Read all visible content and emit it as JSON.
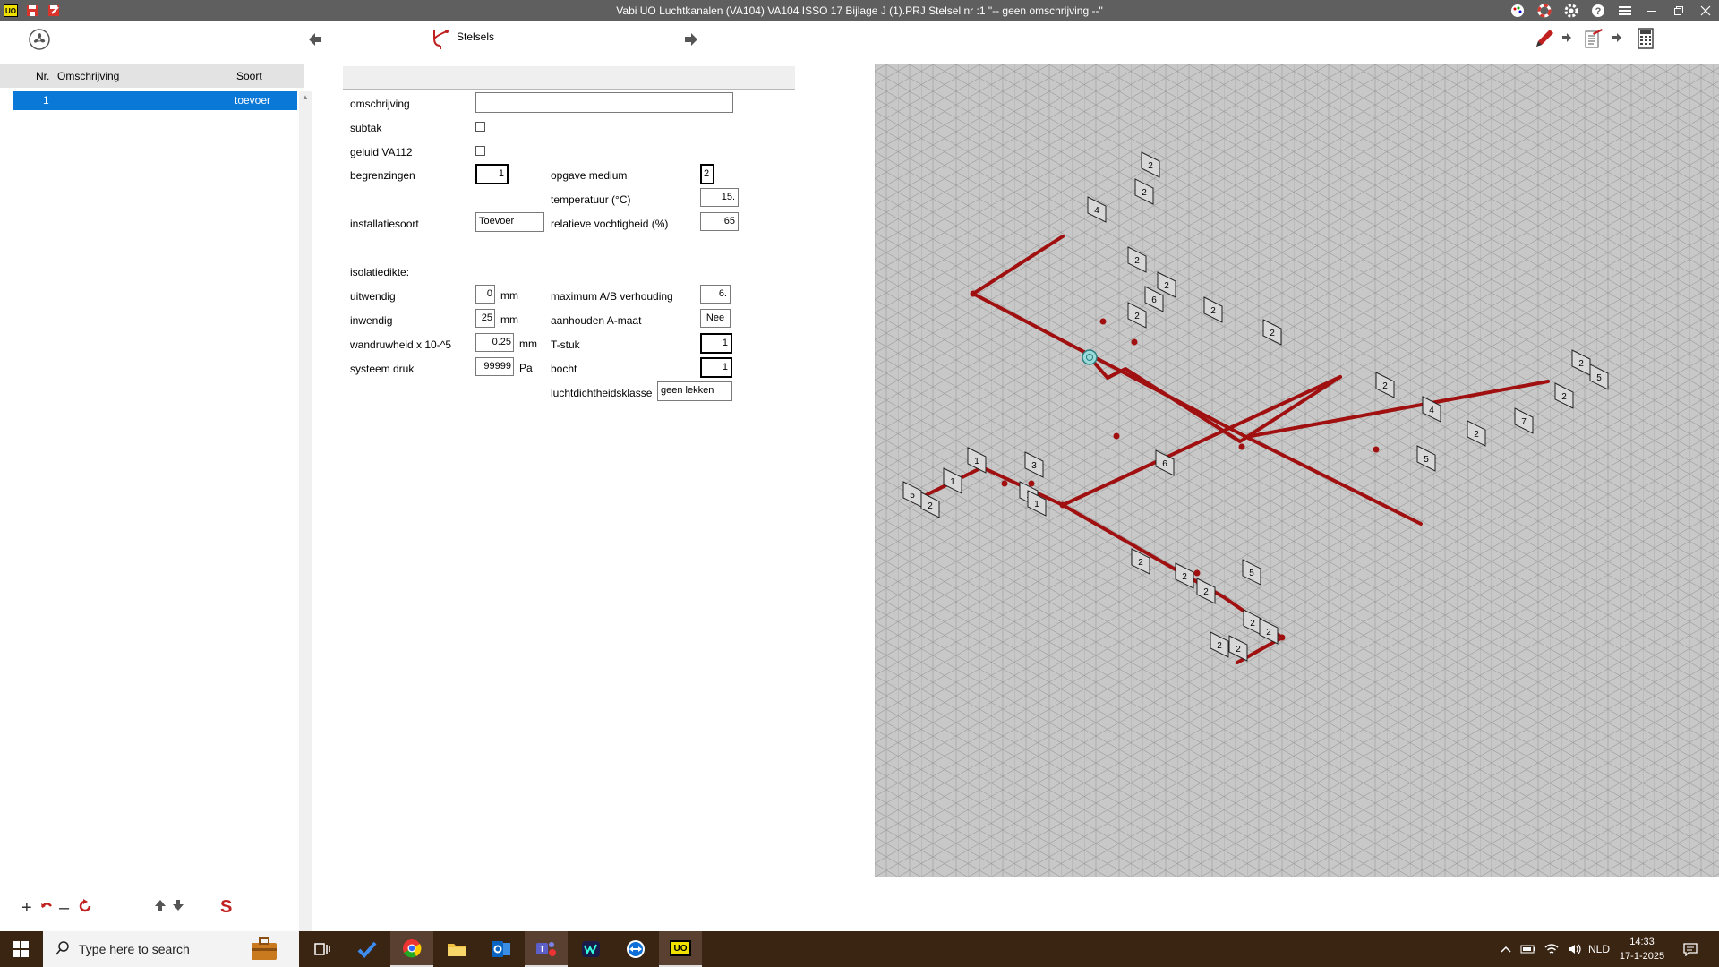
{
  "window": {
    "title": "Vabi UO Luchtkanalen (VA104)  VA104 ISSO 17 Bijlage J (1).PRJ      Stelsel nr   :1  \"-- geen omschrijving --\"",
    "app_badge": "UO"
  },
  "toolbar": {
    "stelsels_label": "Stelsels"
  },
  "list": {
    "headers": {
      "nr": "Nr.",
      "omschrijving": "Omschrijving",
      "soort": "Soort"
    },
    "rows": [
      {
        "nr": "1",
        "omschrijving": "",
        "soort": "toevoer"
      }
    ]
  },
  "form": {
    "omschrijving": {
      "label": "omschrijving",
      "value": ""
    },
    "subtak": {
      "label": "subtak",
      "checked": false
    },
    "geluid": {
      "label": "geluid VA112",
      "checked": false
    },
    "begrenzingen": {
      "label": "begrenzingen",
      "value": "1"
    },
    "opgave_medium": {
      "label": "opgave medium",
      "value": "2"
    },
    "temperatuur": {
      "label": "temperatuur (°C)",
      "value": "15."
    },
    "installatiesoort": {
      "label": "installatiesoort",
      "value": "Toevoer"
    },
    "vochtigheid": {
      "label": "relatieve vochtigheid (%)",
      "value": "65"
    },
    "isolatiedikte": {
      "label": "isolatiedikte:"
    },
    "uitwendig": {
      "label": "uitwendig",
      "value": "0",
      "unit": "mm"
    },
    "max_ab": {
      "label": "maximum A/B verhouding",
      "value": "6."
    },
    "inwendig": {
      "label": "inwendig",
      "value": "25",
      "unit": "mm"
    },
    "aanhouden": {
      "label": "aanhouden A-maat",
      "value": "Nee"
    },
    "wandruwheid": {
      "label": "wandruwheid x 10-^5",
      "value": "0.25",
      "unit": "mm"
    },
    "tstuk": {
      "label": "T-stuk",
      "value": "1"
    },
    "systeem_druk": {
      "label": "systeem druk",
      "value": "99999",
      "unit": "Pa"
    },
    "bocht": {
      "label": "bocht",
      "value": "1"
    },
    "luchtdichtheid": {
      "label": "luchtdichtheidsklasse",
      "value": "geen lekken"
    }
  },
  "drawing": {
    "duct_color": "#a01010",
    "background": "#c8c8c8",
    "tags": [
      "2",
      "2",
      "4",
      "2",
      "2",
      "6",
      "2",
      "2",
      "2",
      "2",
      "4",
      "2",
      "5",
      "2",
      "5",
      "2",
      "7",
      "6",
      "3",
      "1",
      "1",
      "1",
      "1",
      "5",
      "2",
      "2",
      "2",
      "2",
      "5",
      "2",
      "2",
      "2",
      "2"
    ]
  },
  "taskbar": {
    "search_placeholder": "Type here to search",
    "language": "NLD",
    "time": "14:33",
    "date": "17-1-2025",
    "active_badge": "UO"
  }
}
